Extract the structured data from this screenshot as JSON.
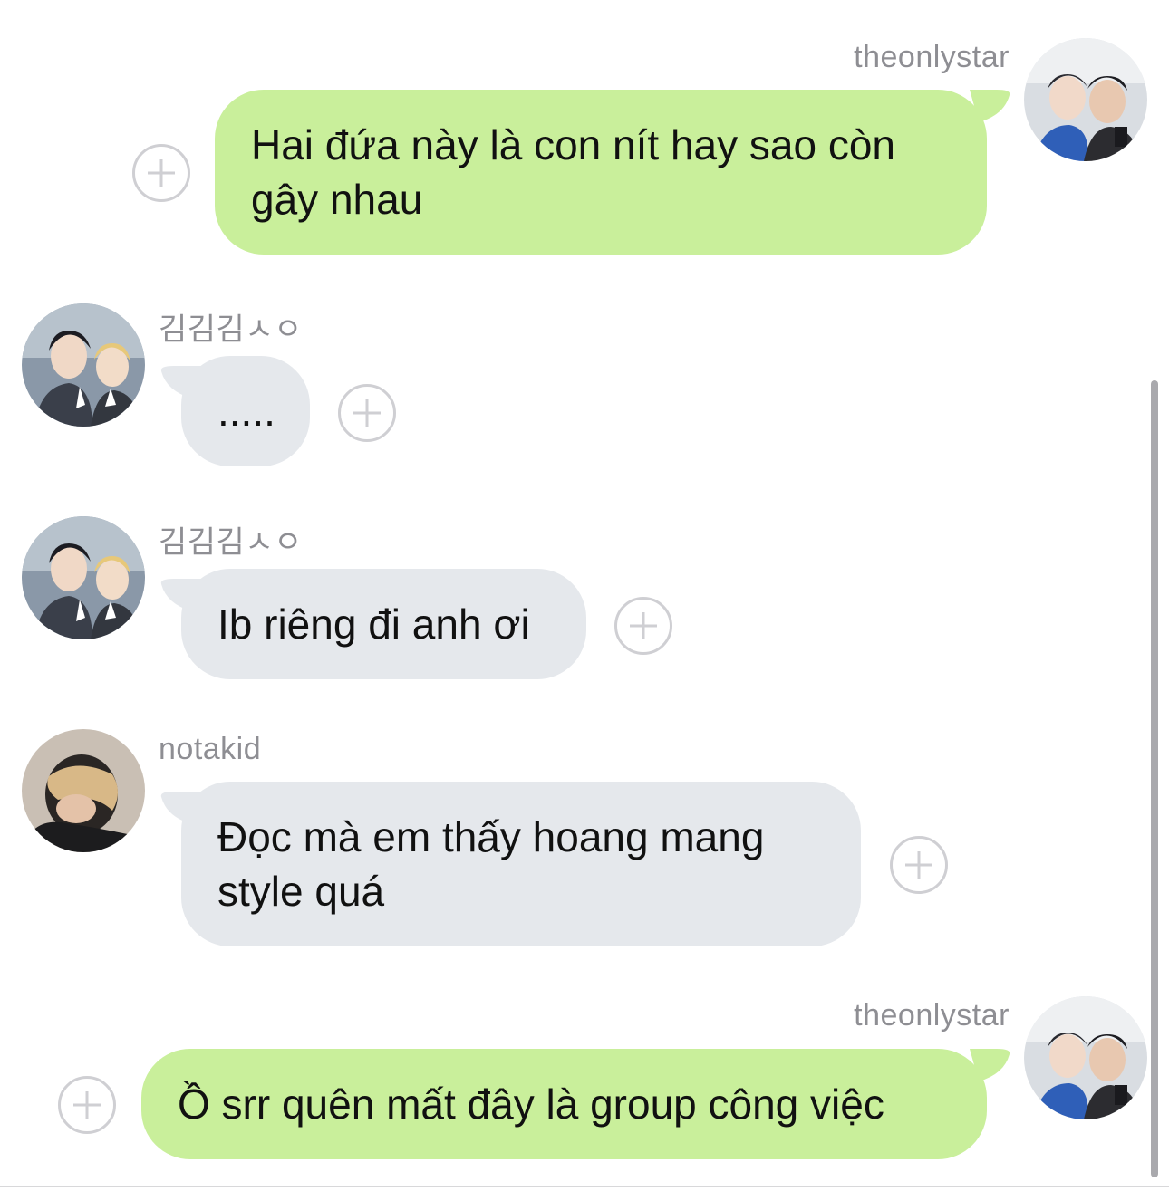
{
  "colors": {
    "outgoing_bubble": "#c9ef9b",
    "incoming_bubble": "#e5e8ec",
    "sender_name": "#8e8e93",
    "plus_icon": "#cfcfd3",
    "scrollbar": "#a9a9ad"
  },
  "messages": [
    {
      "direction": "outgoing",
      "sender": "theonlystar",
      "text_lines": [
        "Hai đứa này là con nít hay sao còn",
        "gây nhau"
      ],
      "avatar_icon": "avatar-photo-icon",
      "action_icon": "add-reaction-icon"
    },
    {
      "direction": "incoming",
      "sender": "김김김ㅅㅇ",
      "text_lines": [
        "....."
      ],
      "avatar_icon": "avatar-photo-icon",
      "action_icon": "add-reaction-icon"
    },
    {
      "direction": "incoming",
      "sender": "김김김ㅅㅇ",
      "text_lines": [
        "Ib riêng đi anh ơi"
      ],
      "avatar_icon": "avatar-photo-icon",
      "action_icon": "add-reaction-icon"
    },
    {
      "direction": "incoming",
      "sender": "notakid",
      "text_lines": [
        "Đọc mà em thấy hoang mang",
        "style quá"
      ],
      "avatar_icon": "avatar-photo-icon",
      "action_icon": "add-reaction-icon"
    },
    {
      "direction": "outgoing",
      "sender": "theonlystar",
      "text_lines": [
        "Ồ srr quên mất đây là group công việc"
      ],
      "avatar_icon": "avatar-photo-icon",
      "action_icon": "add-reaction-icon"
    }
  ]
}
